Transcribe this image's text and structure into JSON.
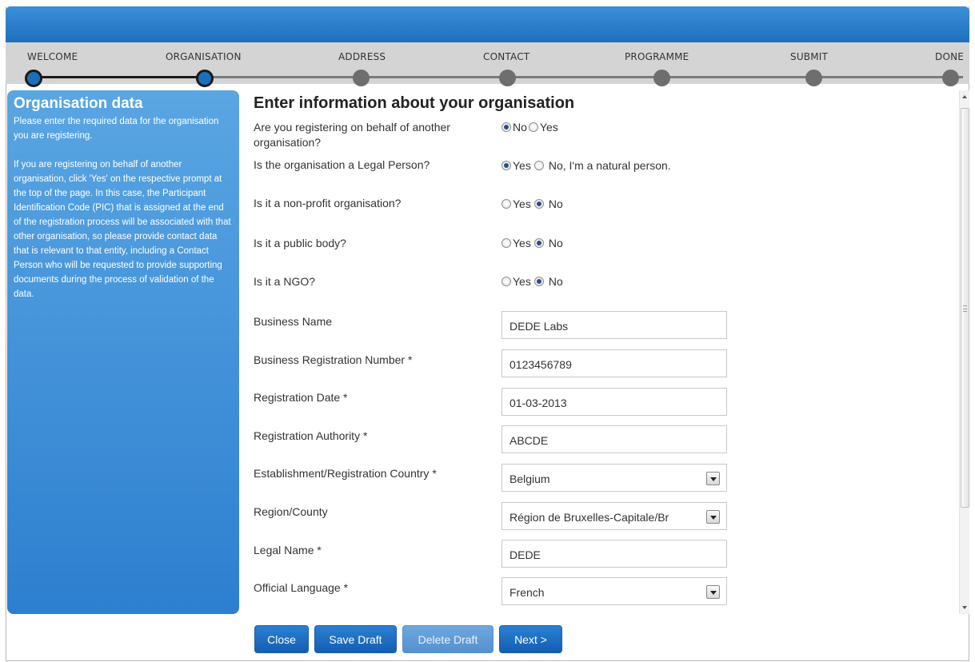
{
  "wizard": {
    "steps": [
      {
        "label": "WELCOME",
        "state": "completed"
      },
      {
        "label": "ORGANISATION",
        "state": "current"
      },
      {
        "label": "ADDRESS",
        "state": "pending"
      },
      {
        "label": "CONTACT",
        "state": "pending"
      },
      {
        "label": "PROGRAMME",
        "state": "pending"
      },
      {
        "label": "SUBMIT",
        "state": "pending"
      },
      {
        "label": "DONE",
        "state": "pending"
      }
    ]
  },
  "sidebar": {
    "title": "Organisation data",
    "para1": "Please enter the required data for the organisation you are registering.",
    "para2": "If you are registering on behalf of another organisation, click 'Yes' on the respective prompt at the top of the page. In this case, the Participant Identification Code (PIC) that is assigned at the end of the registration process will be associated with that other organisation, so please provide contact data that is relevant to that entity, including a Contact Person who will be requested to provide supporting documents during the process of validation of the data."
  },
  "form": {
    "heading": "Enter information about your organisation",
    "questions": [
      {
        "label": "Are you registering on behalf of another organisation?",
        "options": [
          "No",
          "Yes"
        ],
        "selected": "No"
      },
      {
        "label": "Is the organisation a Legal Person?",
        "options": [
          "Yes",
          "No, I'm a natural person."
        ],
        "selected": "Yes"
      },
      {
        "label": "Is it a non-profit organisation?",
        "options": [
          "Yes",
          "No"
        ],
        "selected": "No"
      },
      {
        "label": "Is it a public body?",
        "options": [
          "Yes",
          "No"
        ],
        "selected": "No"
      },
      {
        "label": "Is it a NGO?",
        "options": [
          "Yes",
          "No"
        ],
        "selected": "No"
      }
    ],
    "fields": {
      "business_name": {
        "label": "Business Name",
        "value": "DEDE Labs"
      },
      "business_reg_number": {
        "label": "Business Registration Number *",
        "value": "0123456789"
      },
      "registration_date": {
        "label": "Registration Date *",
        "value": "01-03-2013"
      },
      "registration_authority": {
        "label": "Registration Authority *",
        "value": "ABCDE"
      },
      "country": {
        "label": "Establishment/Registration Country *",
        "value": "Belgium"
      },
      "region": {
        "label": "Region/County",
        "value": "Région de Bruxelles-Capitale/Br"
      },
      "legal_name": {
        "label": "Legal Name *",
        "value": "DEDE"
      },
      "official_language": {
        "label": "Official Language *",
        "value": "French"
      }
    }
  },
  "buttons": {
    "close": "Close",
    "save_draft": "Save Draft",
    "delete_draft": "Delete Draft",
    "next": "Next >"
  },
  "colors": {
    "header_blue": "#1f6fbe",
    "sidebar_blue": "#3c8fd8",
    "button_blue": "#135fb2",
    "button_disabled": "#6fa8df"
  }
}
